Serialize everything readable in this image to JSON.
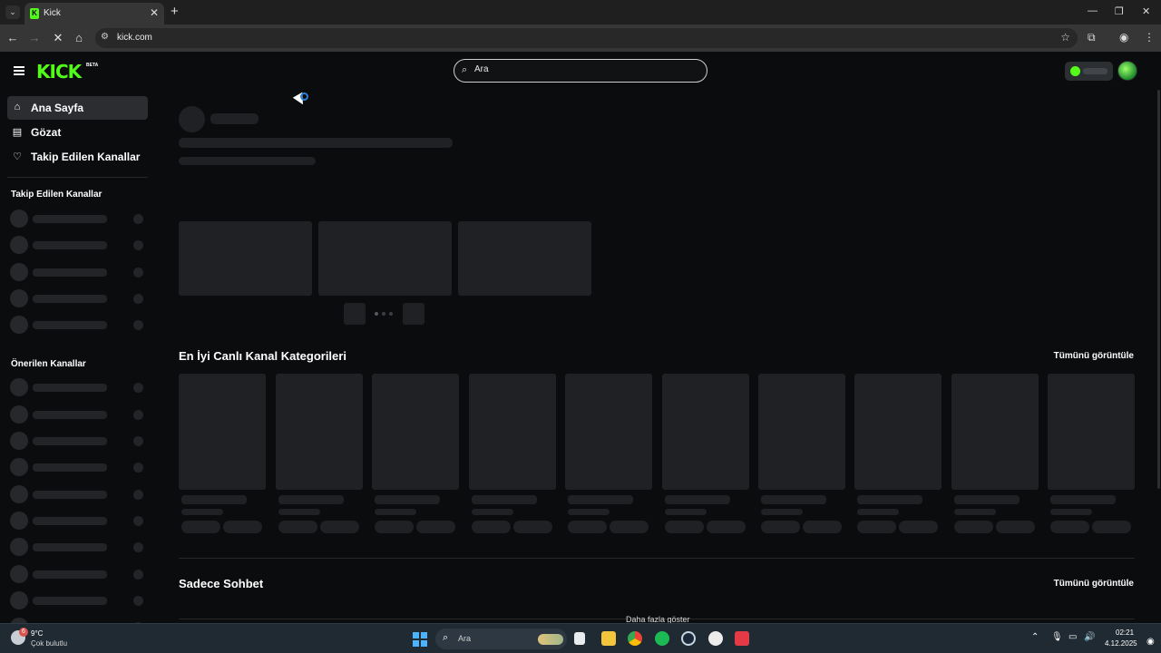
{
  "browser": {
    "tab_title": "Kick",
    "url": "kick.com",
    "new_tab_symbol": "+",
    "close_tab_symbol": "✕"
  },
  "header": {
    "logo_text": "KICK",
    "logo_badge": "BETA",
    "search_placeholder": "Ara"
  },
  "sidebar": {
    "nav": [
      {
        "label": "Ana Sayfa",
        "icon": "home-icon",
        "active": true
      },
      {
        "label": "Gözat",
        "icon": "browse-icon",
        "active": false
      },
      {
        "label": "Takip Edilen Kanallar",
        "icon": "heart-icon",
        "active": false
      }
    ],
    "followed_heading": "Takip Edilen Kanallar",
    "recommended_heading": "Önerilen Kanallar"
  },
  "main": {
    "section_categories": "En İyi Canlı Kanal Kategorileri",
    "section_chat": "Sadece Sohbet",
    "see_all": "Tümünü görüntüle",
    "show_more": "Daha fazla göster"
  },
  "taskbar": {
    "weather_badge": "6",
    "temperature": "9°C",
    "condition": "Çok bulutlu",
    "search_placeholder": "Ara",
    "time": "02:21",
    "date": "4.12.2025"
  },
  "colors": {
    "brand": "#53fc18",
    "background": "#0b0c0d",
    "skeleton": "#1f2124"
  }
}
